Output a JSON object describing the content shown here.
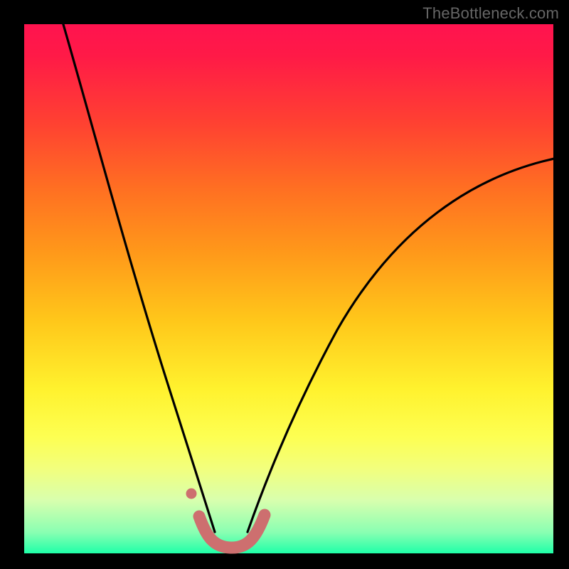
{
  "watermark": "TheBottleneck.com",
  "colors": {
    "background": "#000000",
    "curve": "#000000",
    "marker": "#cd6f6f",
    "gradient_top": "#ff134f",
    "gradient_bottom": "#1fffa8"
  },
  "chart_data": {
    "type": "line",
    "title": "",
    "xlabel": "",
    "ylabel": "",
    "xlim": [
      0,
      100
    ],
    "ylim": [
      0,
      100
    ],
    "series": [
      {
        "name": "left-curve",
        "x": [
          7,
          10,
          13,
          16,
          19,
          22,
          25,
          27,
          29,
          31,
          33,
          34.5,
          36
        ],
        "values": [
          100,
          87,
          75,
          64,
          54,
          44,
          34,
          27,
          20,
          13.5,
          7,
          3,
          0
        ]
      },
      {
        "name": "right-curve",
        "x": [
          42,
          44,
          46,
          49,
          52,
          56,
          60,
          65,
          70,
          76,
          82,
          89,
          96,
          100
        ],
        "values": [
          0,
          3,
          7,
          13,
          19,
          26,
          33,
          40,
          47,
          54,
          60,
          66,
          72,
          75
        ]
      },
      {
        "name": "bottom-segment",
        "x": [
          33,
          35,
          37,
          39,
          41,
          43,
          45
        ],
        "values": [
          6,
          2,
          0.5,
          0,
          0.5,
          2,
          6
        ]
      },
      {
        "name": "left-dot",
        "x": [
          31.5
        ],
        "values": [
          11
        ]
      }
    ]
  }
}
